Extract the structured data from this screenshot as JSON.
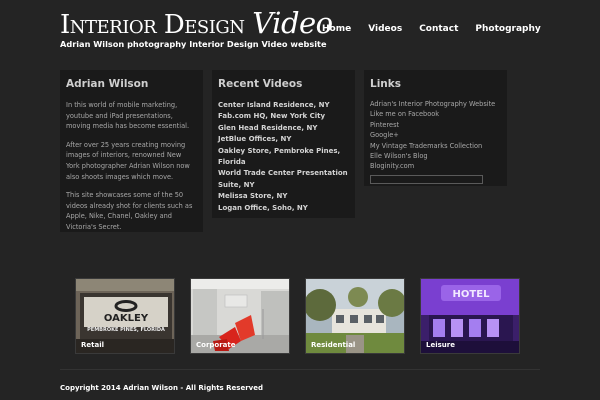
{
  "header": {
    "logo_word1": "Interior",
    "logo_word2": "Design",
    "logo_word3": "Video",
    "tagline": "Adrian Wilson photography Interior Design Video website"
  },
  "nav": {
    "items": [
      {
        "label": "Home"
      },
      {
        "label": "Videos"
      },
      {
        "label": "Contact"
      },
      {
        "label": "Photography"
      }
    ]
  },
  "about": {
    "title": "Adrian Wilson",
    "paragraphs": [
      "In this world of mobile marketing, youtube and iPad presentations, moving media has become essential.",
      "After over 25 years creating moving images of interiors, renowned New York photographer Adrian Wilson now also shoots images which move.",
      "This site showcases some of the 50 videos already shot for clients such as Apple, Nike, Chanel, Oakley and Victoria's Secret."
    ]
  },
  "recent_videos": {
    "title": "Recent Videos",
    "items": [
      "Center Island Residence, NY",
      "Fab.com HQ, New York City",
      "Glen Head Residence, NY",
      "JetBlue Offices, NY",
      "Oakley Store, Pembroke Pines, Florida",
      "World Trade Center Presentation Suite, NY",
      "Melissa Store, NY",
      "Logan Office, Soho, NY"
    ]
  },
  "links": {
    "title": "Links",
    "items": [
      "Adrian's Interior Photography Website",
      "Like me on Facebook",
      "Pinterest",
      "Google+",
      "My Vintage Trademarks Collection",
      "Elle Wilson's Blog",
      "Bloginity.com"
    ]
  },
  "gallery": {
    "items": [
      {
        "caption": "Retail",
        "sign_text": "OAKLEY",
        "sub_text": "PEMBROKE PINES, FLORIDA"
      },
      {
        "caption": "Corporate"
      },
      {
        "caption": "Residential"
      },
      {
        "caption": "Leisure",
        "sign_text": "HOTEL"
      }
    ]
  },
  "footer": {
    "copyright": "Copyright 2014 Adrian Wilson - All Rights Reserved"
  },
  "colors": {
    "background": "#242424",
    "panel": "#1a1a1a",
    "text_light": "#ffffff",
    "text_muted": "#a8a8a8",
    "leisure_purple": "#7a3fd0"
  }
}
